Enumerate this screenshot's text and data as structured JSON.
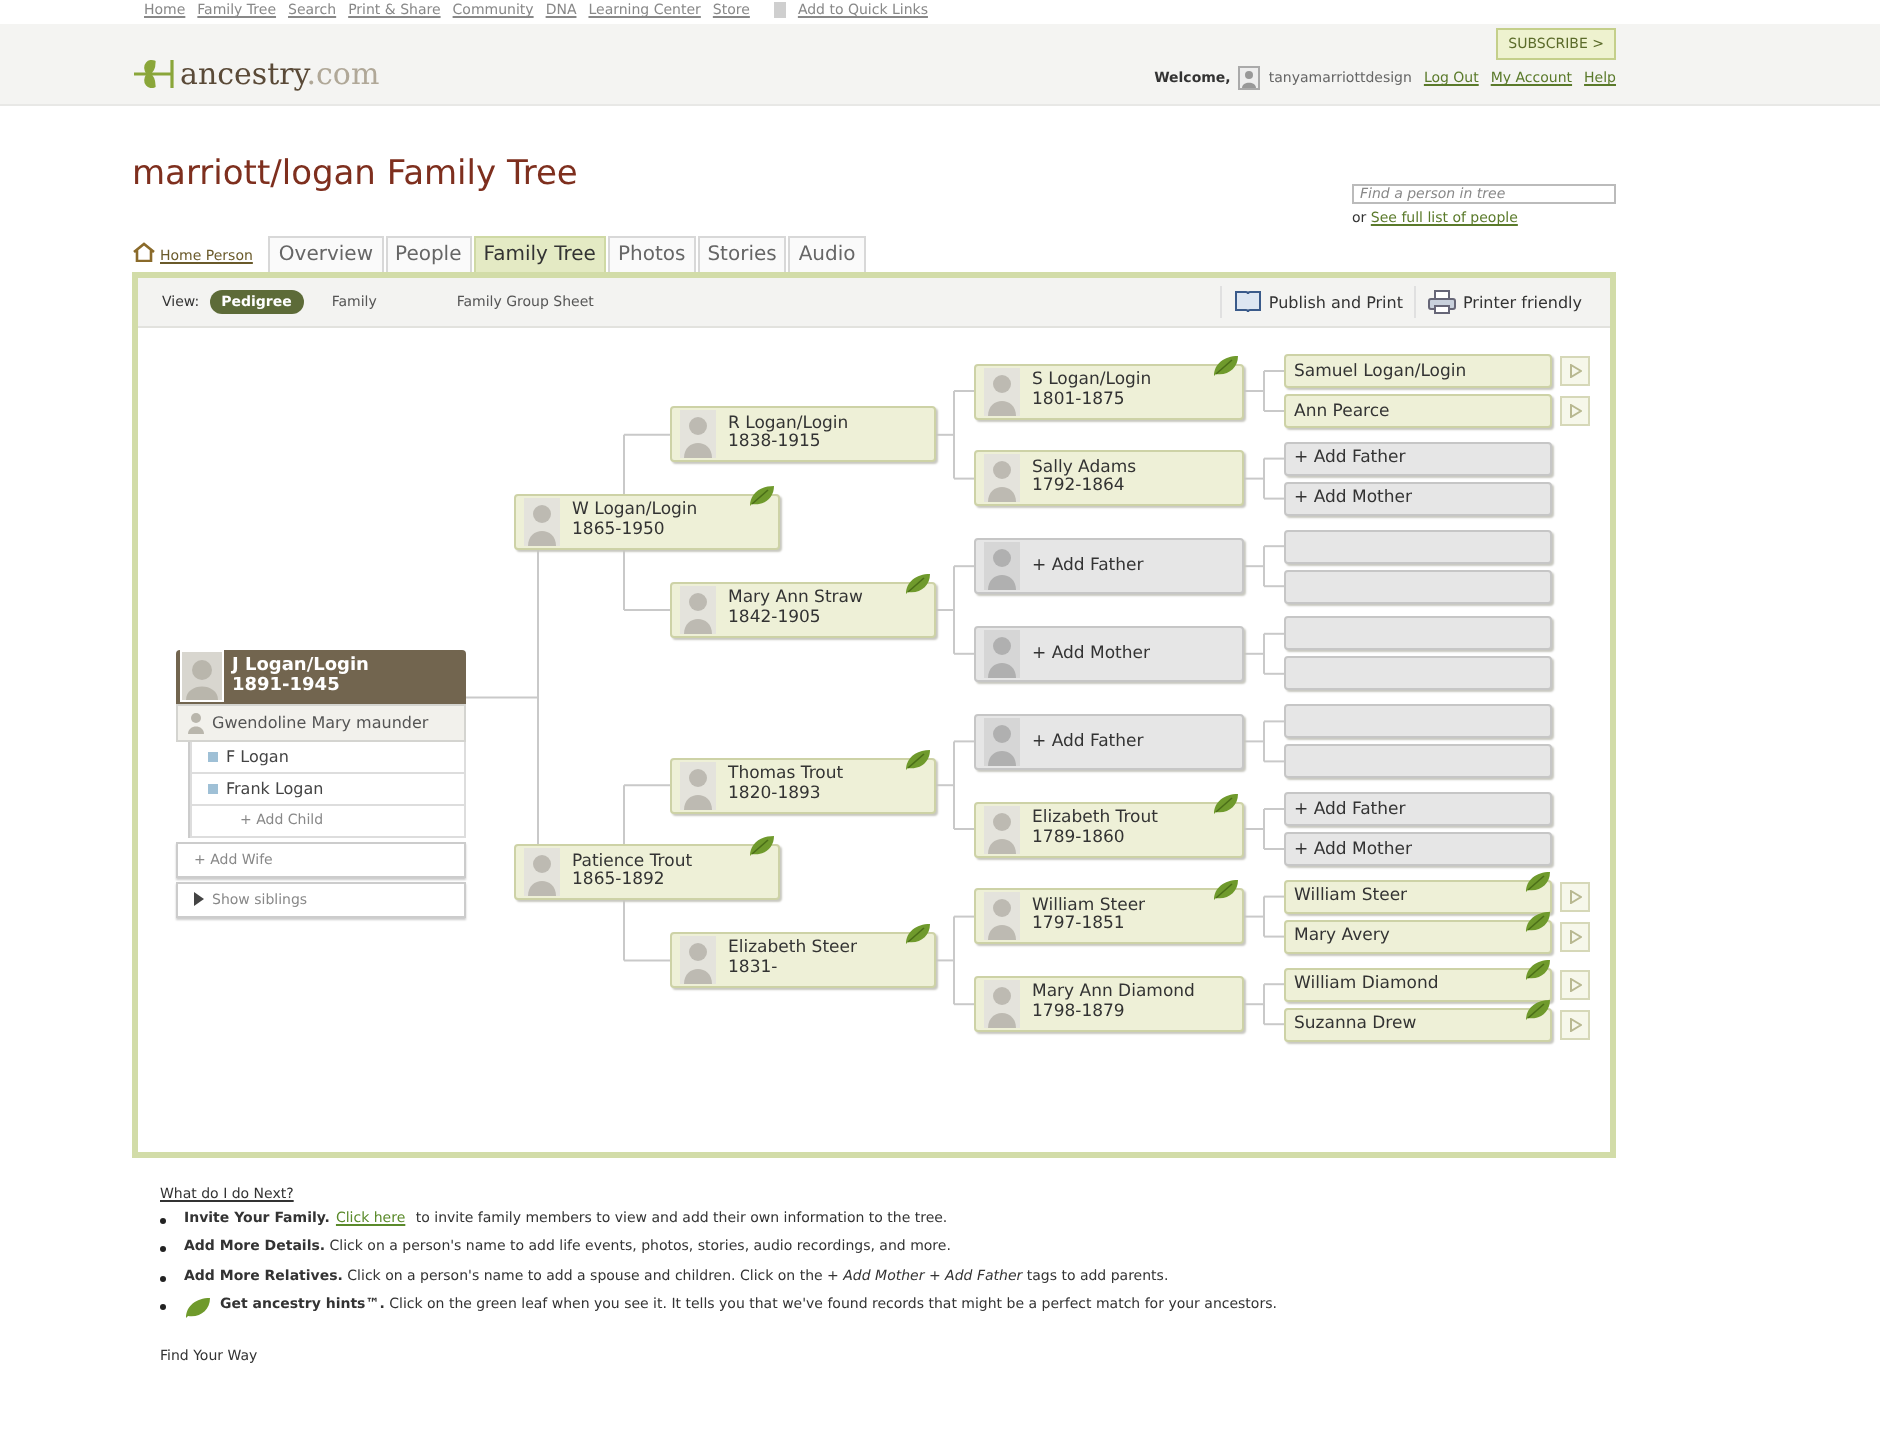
{
  "top_nav": {
    "links": [
      "Home",
      "Family Tree",
      "Search",
      "Print & Share",
      "Community",
      "DNA",
      "Learning Center",
      "Store"
    ],
    "quick_links": "Add to Quick Links"
  },
  "header": {
    "logo": "ancestry",
    "logo_suffix": ".com",
    "subscribe": "SUBSCRIBE >",
    "welcome": "Welcome,",
    "user": "tanyamarriottdesign",
    "links": [
      "Log Out",
      "My Account",
      "Help"
    ]
  },
  "title": "marriott/logan Family Tree",
  "find": {
    "placeholder": "Find a person in tree",
    "or": "or",
    "link": "See full list of people"
  },
  "home_person": "Home Person",
  "tabs": [
    {
      "label": "Overview",
      "selected": false
    },
    {
      "label": "People",
      "selected": false
    },
    {
      "label": "Family Tree",
      "selected": true
    },
    {
      "label": "Photos",
      "selected": false
    },
    {
      "label": "Stories",
      "selected": false
    },
    {
      "label": "Audio",
      "selected": false
    }
  ],
  "toolbar": {
    "view_label": "View:",
    "views": [
      {
        "label": "Pedigree",
        "selected": true
      },
      {
        "label": "Family",
        "selected": false
      },
      {
        "label": "Family Group Sheet",
        "selected": false
      }
    ],
    "actions": [
      {
        "kind": "publish",
        "label": "Publish and Print"
      },
      {
        "kind": "print",
        "label": "Printer friendly"
      }
    ]
  },
  "tree": {
    "name": "J Logan/Login",
    "dates": "1891-1945",
    "spouse": "Gwendoline Mary maunder",
    "children": [
      {
        "name": "F Logan"
      },
      {
        "name": "Frank Logan"
      }
    ],
    "add_child": "+ Add Child",
    "add_wife": "+ Add Wife",
    "show_siblings": "Show siblings",
    "parents": [
      {
        "kind": "person",
        "name": "W Logan/Login",
        "dates": "1865-1950",
        "hint": true,
        "parents": [
          {
            "kind": "person",
            "name": "R Logan/Login",
            "dates": "1838-1915",
            "hint": false,
            "parents": [
              {
                "kind": "person",
                "name": "S Logan/Login",
                "dates": "1801-1875",
                "hint": true,
                "parents": [
                  {
                    "kind": "person",
                    "name": "Samuel Logan/Login",
                    "hint": false,
                    "more": true
                  },
                  {
                    "kind": "person",
                    "name": "Ann Pearce",
                    "hint": false,
                    "more": true
                  }
                ]
              },
              {
                "kind": "person",
                "name": "Sally Adams",
                "dates": "1792-1864",
                "hint": false,
                "parents": [
                  {
                    "kind": "add",
                    "label": "+ Add Father"
                  },
                  {
                    "kind": "add",
                    "label": "+ Add Mother"
                  }
                ]
              }
            ]
          },
          {
            "kind": "person",
            "name": "Mary Ann Straw",
            "dates": "1842-1905",
            "hint": true,
            "parents": [
              {
                "kind": "add",
                "label": "+ Add Father",
                "parents": [
                  {
                    "kind": "empty"
                  },
                  {
                    "kind": "empty"
                  }
                ]
              },
              {
                "kind": "add",
                "label": "+ Add Mother",
                "parents": [
                  {
                    "kind": "empty"
                  },
                  {
                    "kind": "empty"
                  }
                ]
              }
            ]
          }
        ]
      },
      {
        "kind": "person",
        "name": "Patience Trout",
        "dates": "1865-1892",
        "hint": true,
        "parents": [
          {
            "kind": "person",
            "name": "Thomas Trout",
            "dates": "1820-1893",
            "hint": true,
            "parents": [
              {
                "kind": "add",
                "label": "+ Add Father",
                "parents": [
                  {
                    "kind": "empty"
                  },
                  {
                    "kind": "empty"
                  }
                ]
              },
              {
                "kind": "person",
                "name": "Elizabeth Trout",
                "dates": "1789-1860",
                "hint": true,
                "parents": [
                  {
                    "kind": "add",
                    "label": "+ Add Father"
                  },
                  {
                    "kind": "add",
                    "label": "+ Add Mother"
                  }
                ]
              }
            ]
          },
          {
            "kind": "person",
            "name": "Elizabeth Steer",
            "dates": "1831-",
            "hint": true,
            "parents": [
              {
                "kind": "person",
                "name": "William Steer",
                "dates": "1797-1851",
                "hint": true,
                "parents": [
                  {
                    "kind": "person",
                    "name": "William Steer",
                    "hint": true,
                    "more": true
                  },
                  {
                    "kind": "person",
                    "name": "Mary Avery",
                    "hint": true,
                    "more": true
                  }
                ]
              },
              {
                "kind": "person",
                "name": "Mary Ann Diamond",
                "dates": "1798-1879",
                "hint": false,
                "parents": [
                  {
                    "kind": "person",
                    "name": "William Diamond",
                    "hint": true,
                    "more": true
                  },
                  {
                    "kind": "person",
                    "name": "Suzanna Drew",
                    "hint": true,
                    "more": true
                  }
                ]
              }
            ]
          }
        ]
      }
    ]
  },
  "next": {
    "heading": "What do I do Next?",
    "tips": [
      {
        "icon": false,
        "before": "**Invite Your Family.**",
        "link": "Click here",
        "after": "to invite family members to view and add their own information to the tree."
      },
      {
        "icon": false,
        "before": "**Add More Details.** Click on a person's name to add life events, photos, stories, audio recordings, and more."
      },
      {
        "icon": false,
        "before": "**Add More Relatives.** Click on a person's name to add a spouse and children. Click on the *+ Add Mother + Add Father* tags to add parents."
      },
      {
        "icon": true,
        "before": "**Get ancestry hints™.** Click on the green leaf when you see it. It tells you that we've found records that might be a perfect match for your ancestors."
      }
    ]
  },
  "find_your_way": "Find Your Way"
}
